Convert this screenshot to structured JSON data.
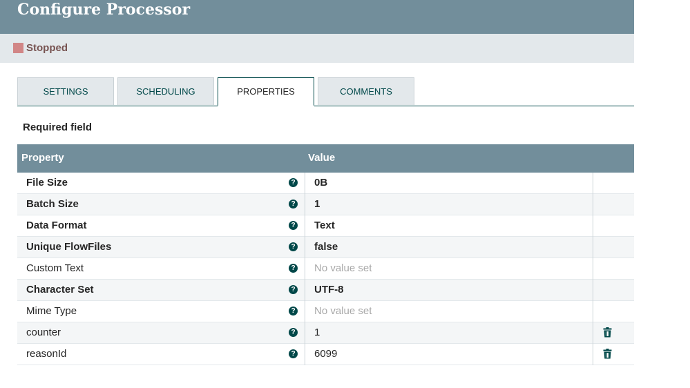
{
  "header": {
    "title": "Configure Processor"
  },
  "status": {
    "label": "Stopped",
    "color": "#d18686"
  },
  "tabs": [
    {
      "label": "SETTINGS",
      "active": false
    },
    {
      "label": "SCHEDULING",
      "active": false
    },
    {
      "label": "PROPERTIES",
      "active": true
    },
    {
      "label": "COMMENTS",
      "active": false
    }
  ],
  "required_label": "Required field",
  "table": {
    "columns": {
      "property": "Property",
      "value": "Value"
    },
    "rows": [
      {
        "name": "File Size",
        "value": "0B",
        "required": true,
        "unset": false,
        "deletable": false
      },
      {
        "name": "Batch Size",
        "value": "1",
        "required": true,
        "unset": false,
        "deletable": false
      },
      {
        "name": "Data Format",
        "value": "Text",
        "required": true,
        "unset": false,
        "deletable": false
      },
      {
        "name": "Unique FlowFiles",
        "value": "false",
        "required": true,
        "unset": false,
        "deletable": false
      },
      {
        "name": "Custom Text",
        "value": "No value set",
        "required": false,
        "unset": true,
        "deletable": false
      },
      {
        "name": "Character Set",
        "value": "UTF-8",
        "required": true,
        "unset": false,
        "deletable": false
      },
      {
        "name": "Mime Type",
        "value": "No value set",
        "required": false,
        "unset": true,
        "deletable": false
      },
      {
        "name": "counter",
        "value": "1",
        "required": false,
        "unset": false,
        "deletable": true
      },
      {
        "name": "reasonId",
        "value": "6099",
        "required": false,
        "unset": false,
        "deletable": true
      }
    ]
  },
  "icons": {
    "help": "question-circle-icon",
    "delete": "trash-icon"
  },
  "colors": {
    "header": "#728e9b",
    "accent": "#004849",
    "status_bar": "#e3e8eb"
  }
}
